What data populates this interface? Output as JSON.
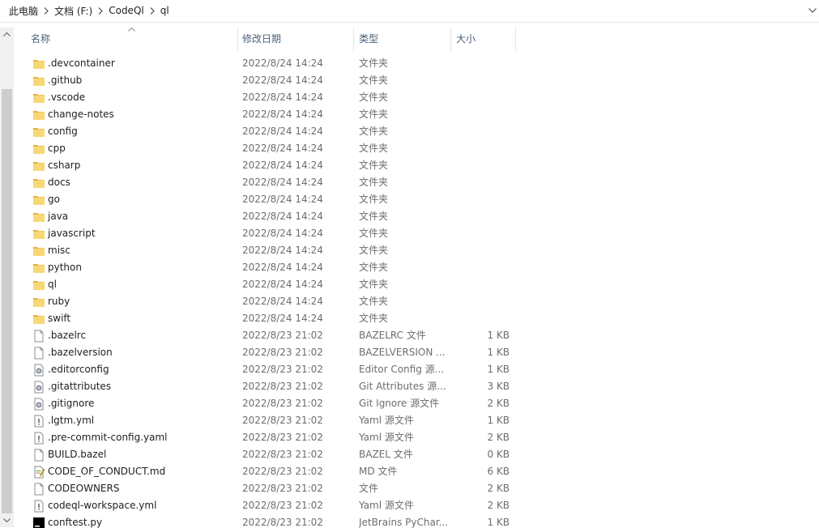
{
  "breadcrumb": [
    "此电脑",
    "文档 (F:)",
    "CodeQl",
    "ql"
  ],
  "columns": {
    "name": "名称",
    "modified": "修改日期",
    "type": "类型",
    "size": "大小"
  },
  "colors": {
    "folder": "#f8d775",
    "header_text": "#4c607a",
    "meta_text": "#6d6d6d"
  },
  "files": [
    {
      "name": ".devcontainer",
      "date": "2022/8/24 14:24",
      "type": "文件夹",
      "size": "",
      "icon": "folder-icon"
    },
    {
      "name": ".github",
      "date": "2022/8/24 14:24",
      "type": "文件夹",
      "size": "",
      "icon": "folder-icon"
    },
    {
      "name": ".vscode",
      "date": "2022/8/24 14:24",
      "type": "文件夹",
      "size": "",
      "icon": "folder-icon"
    },
    {
      "name": "change-notes",
      "date": "2022/8/24 14:24",
      "type": "文件夹",
      "size": "",
      "icon": "folder-icon"
    },
    {
      "name": "config",
      "date": "2022/8/24 14:24",
      "type": "文件夹",
      "size": "",
      "icon": "folder-icon"
    },
    {
      "name": "cpp",
      "date": "2022/8/24 14:24",
      "type": "文件夹",
      "size": "",
      "icon": "folder-icon"
    },
    {
      "name": "csharp",
      "date": "2022/8/24 14:24",
      "type": "文件夹",
      "size": "",
      "icon": "folder-icon"
    },
    {
      "name": "docs",
      "date": "2022/8/24 14:24",
      "type": "文件夹",
      "size": "",
      "icon": "folder-icon"
    },
    {
      "name": "go",
      "date": "2022/8/24 14:24",
      "type": "文件夹",
      "size": "",
      "icon": "folder-icon"
    },
    {
      "name": "java",
      "date": "2022/8/24 14:24",
      "type": "文件夹",
      "size": "",
      "icon": "folder-icon"
    },
    {
      "name": "javascript",
      "date": "2022/8/24 14:24",
      "type": "文件夹",
      "size": "",
      "icon": "folder-icon"
    },
    {
      "name": "misc",
      "date": "2022/8/24 14:24",
      "type": "文件夹",
      "size": "",
      "icon": "folder-icon"
    },
    {
      "name": "python",
      "date": "2022/8/24 14:24",
      "type": "文件夹",
      "size": "",
      "icon": "folder-icon"
    },
    {
      "name": "ql",
      "date": "2022/8/24 14:24",
      "type": "文件夹",
      "size": "",
      "icon": "folder-icon"
    },
    {
      "name": "ruby",
      "date": "2022/8/24 14:24",
      "type": "文件夹",
      "size": "",
      "icon": "folder-icon"
    },
    {
      "name": "swift",
      "date": "2022/8/24 14:24",
      "type": "文件夹",
      "size": "",
      "icon": "folder-icon"
    },
    {
      "name": ".bazelrc",
      "date": "2022/8/23 21:02",
      "type": "BAZELRC 文件",
      "size": "1 KB",
      "icon": "file-icon"
    },
    {
      "name": ".bazelversion",
      "date": "2022/8/23 21:02",
      "type": "BAZELVERSION ...",
      "size": "1 KB",
      "icon": "file-icon"
    },
    {
      "name": ".editorconfig",
      "date": "2022/8/23 21:02",
      "type": "Editor Config 源...",
      "size": "1 KB",
      "icon": "config-file-icon"
    },
    {
      "name": ".gitattributes",
      "date": "2022/8/23 21:02",
      "type": "Git Attributes 源...",
      "size": "3 KB",
      "icon": "config-file-icon"
    },
    {
      "name": ".gitignore",
      "date": "2022/8/23 21:02",
      "type": "Git Ignore 源文件",
      "size": "2 KB",
      "icon": "config-file-icon"
    },
    {
      "name": ".lgtm.yml",
      "date": "2022/8/23 21:02",
      "type": "Yaml 源文件",
      "size": "1 KB",
      "icon": "yaml-file-icon"
    },
    {
      "name": ".pre-commit-config.yaml",
      "date": "2022/8/23 21:02",
      "type": "Yaml 源文件",
      "size": "2 KB",
      "icon": "yaml-file-icon"
    },
    {
      "name": "BUILD.bazel",
      "date": "2022/8/23 21:02",
      "type": "BAZEL 文件",
      "size": "0 KB",
      "icon": "file-icon"
    },
    {
      "name": "CODE_OF_CONDUCT.md",
      "date": "2022/8/23 21:02",
      "type": "MD 文件",
      "size": "6 KB",
      "icon": "markdown-file-icon"
    },
    {
      "name": "CODEOWNERS",
      "date": "2022/8/23 21:02",
      "type": "文件",
      "size": "2 KB",
      "icon": "file-icon"
    },
    {
      "name": "codeql-workspace.yml",
      "date": "2022/8/23 21:02",
      "type": "Yaml 源文件",
      "size": "2 KB",
      "icon": "yaml-file-icon"
    },
    {
      "name": "conftest.py",
      "date": "2022/8/23 21:02",
      "type": "JetBrains PyChar...",
      "size": "1 KB",
      "icon": "pycharm-file-icon"
    }
  ]
}
